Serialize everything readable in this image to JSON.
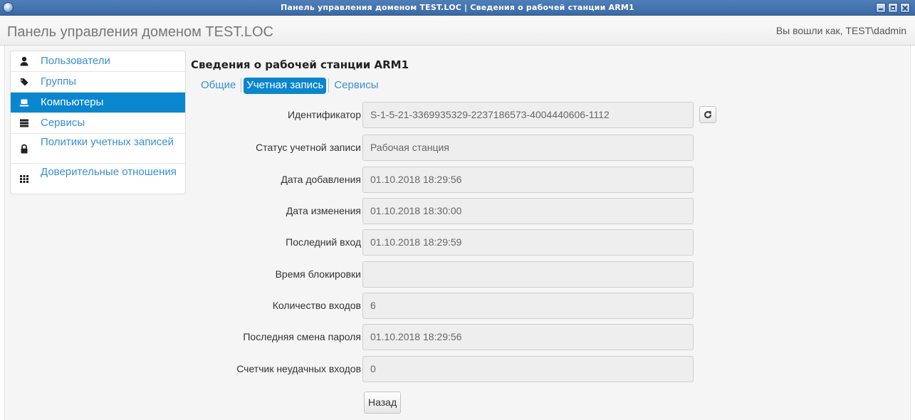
{
  "window": {
    "title": "Панель управления доменом TEST.LOC | Сведения о рабочей станции ARM1"
  },
  "navbar": {
    "brand": "Панель управления доменом TEST.LOC",
    "login_info": "Вы вошли как, TEST\\dadmin"
  },
  "sidebar": {
    "items": [
      {
        "label": "Пользователи",
        "icon": "user-icon",
        "active": false
      },
      {
        "label": "Группы",
        "icon": "tags-icon",
        "active": false
      },
      {
        "label": "Компьютеры",
        "icon": "laptop-icon",
        "active": true
      },
      {
        "label": "Сервисы",
        "icon": "server-icon",
        "active": false
      },
      {
        "label": "Политики учетных записей",
        "icon": "lock-icon",
        "active": false
      },
      {
        "label": "Доверительные отношения",
        "icon": "grid-icon",
        "active": false
      }
    ]
  },
  "main": {
    "title": "Сведения о рабочей станции ARM1",
    "tabs": [
      {
        "label": "Общие",
        "active": false
      },
      {
        "label": "Учетная запись",
        "active": true
      },
      {
        "label": "Сервисы",
        "active": false
      }
    ],
    "fields": [
      {
        "label": "Идентификатор",
        "value": "S-1-5-21-3369935329-2237186573-4004440606-1112"
      },
      {
        "label": "Статус учетной записи",
        "value": "Рабочая станция"
      },
      {
        "label": "Дата добавления",
        "value": "01.10.2018 18:29:56"
      },
      {
        "label": "Дата изменения",
        "value": "01.10.2018 18:30:00"
      },
      {
        "label": "Последний вход",
        "value": "01.10.2018 18:29:59"
      },
      {
        "label": "Время блокировки",
        "value": ""
      },
      {
        "label": "Количество входов",
        "value": "6"
      },
      {
        "label": "Последняя смена пароля",
        "value": "01.10.2018 18:29:56"
      },
      {
        "label": "Счетчик неудачных входов",
        "value": "0"
      }
    ],
    "back_label": "Назад"
  },
  "colors": {
    "accent": "#0a86ce",
    "link": "#3a8fd0",
    "titlebar": "#3b6aa4"
  }
}
